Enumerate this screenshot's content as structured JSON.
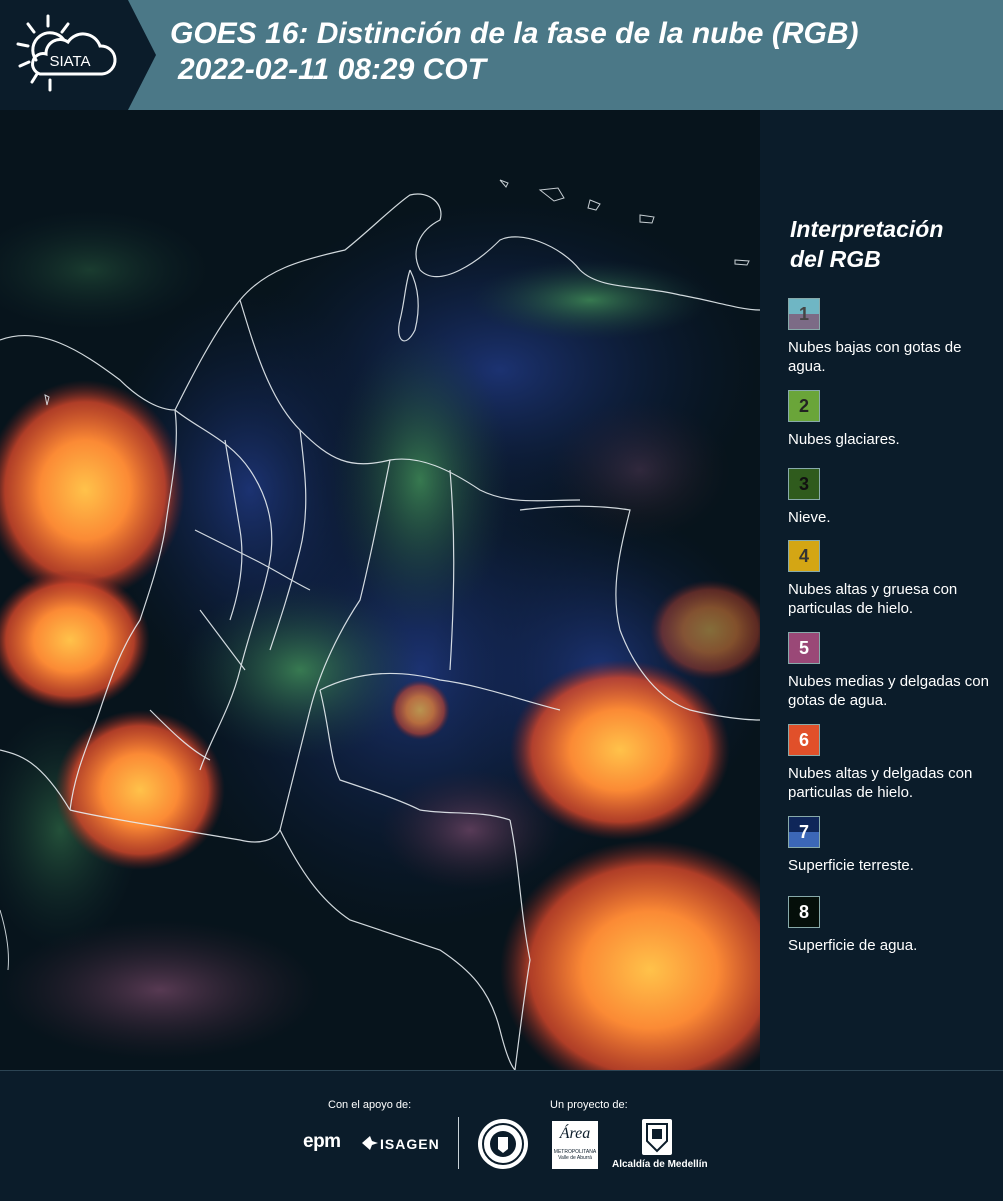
{
  "header": {
    "logo_text": "SIATA",
    "title_line1": "GOES 16: Distinción de la fase de la nube (RGB)",
    "title_line2": "2022-02-11 08:29 COT"
  },
  "legend": {
    "title_line1": "Interpretación",
    "title_line2": "del RGB",
    "items": [
      {
        "number": "1",
        "label": "Nubes bajas con gotas de agua.",
        "color_top": "#6fb6c4",
        "color_bottom": "#7c6b86",
        "text_color": "#444"
      },
      {
        "number": "2",
        "label": "Nubes glaciares.",
        "color_top": "#6aa539",
        "color_bottom": "#6aa539",
        "text_color": "#222"
      },
      {
        "number": "3",
        "label": "Nieve.",
        "color_top": "#2f5b1d",
        "color_bottom": "#2f5b1d",
        "text_color": "#111"
      },
      {
        "number": "4",
        "label": "Nubes altas y gruesa con particulas de hielo.",
        "color_top": "#d4a614",
        "color_bottom": "#d4a614",
        "text_color": "#333"
      },
      {
        "number": "5",
        "label": "Nubes medias y delgadas con gotas de agua.",
        "color_top": "#9a4877",
        "color_bottom": "#9a4877",
        "text_color": "#fff"
      },
      {
        "number": "6",
        "label": "Nubes altas y delgadas con particulas de hielo.",
        "color_top": "#e1502a",
        "color_bottom": "#e1502a",
        "text_color": "#fff"
      },
      {
        "number": "7",
        "label": "Superficie terreste.",
        "color_top": "#0f2659",
        "color_bottom": "#3c67b7",
        "text_color": "#fff"
      },
      {
        "number": "8",
        "label": "Superficie de agua.",
        "color_top": "#050f0a",
        "color_bottom": "#050f0a",
        "text_color": "#fff"
      }
    ]
  },
  "footer": {
    "support_label": "Con el apoyo de:",
    "project_label": "Un proyecto de:",
    "sponsor_epm": "epm",
    "sponsor_isagen": "ISAGEN",
    "partner_area_1": "Área",
    "partner_area_2": "METROPOLITANA",
    "partner_area_3": "Valle de Aburrá",
    "partner_alcaldia": "Alcaldía de Medellín"
  }
}
